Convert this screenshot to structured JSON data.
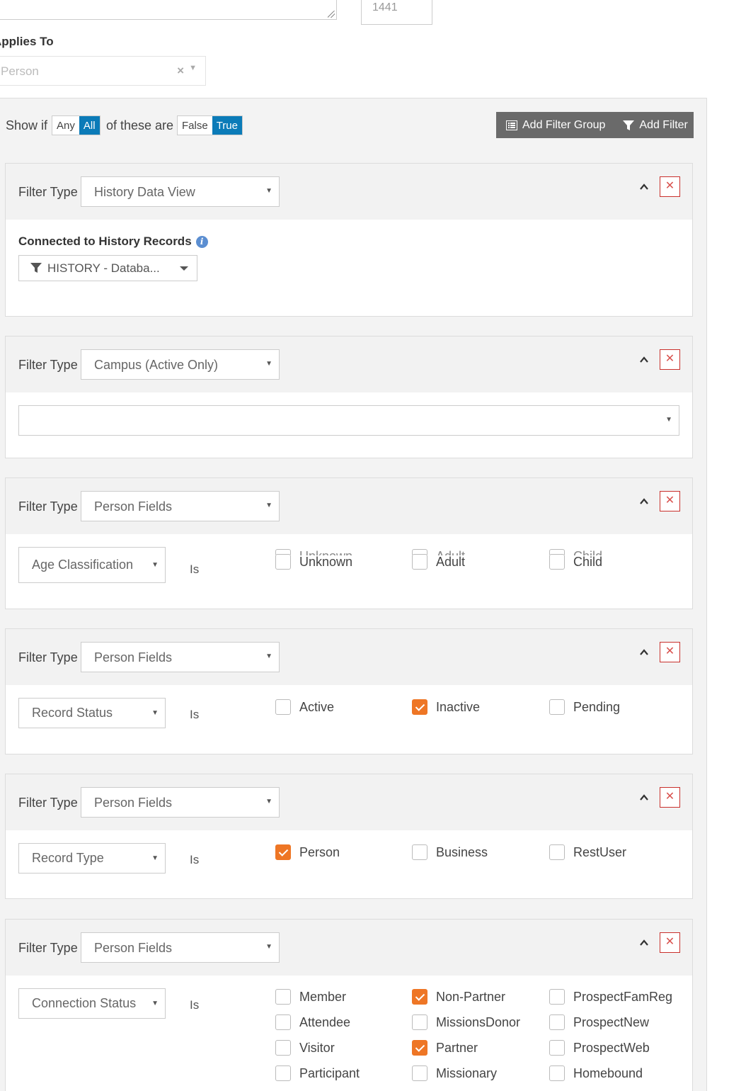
{
  "top": {
    "id_value": "1441",
    "applies_to_label": "Applies To",
    "applies_to_value": "Person"
  },
  "group": {
    "show_if_label": "Show if",
    "any_label": "Any",
    "all_label": "All",
    "of_these_label": "of these are",
    "false_label": "False",
    "true_label": "True",
    "selected_match": "All",
    "selected_truth": "True",
    "add_filter_group_label": "Add Filter Group",
    "add_filter_label": "Add Filter"
  },
  "filter_type_label": "Filter Type",
  "is_label": "Is",
  "filters": [
    {
      "type": "History Data View",
      "connected_label": "Connected to History Records",
      "dataview_value": "HISTORY - Databa..."
    },
    {
      "type": "Campus (Active Only)",
      "campus_value": ""
    },
    {
      "type": "Person Fields",
      "field": "Age Classification",
      "options": [
        {
          "label": "Unknown",
          "checked": false
        },
        {
          "label": "Adult",
          "checked": false
        },
        {
          "label": "Child",
          "checked": false
        }
      ]
    },
    {
      "type": "Person Fields",
      "field": "Record Status",
      "options": [
        {
          "label": "Active",
          "checked": false
        },
        {
          "label": "Inactive",
          "checked": true
        },
        {
          "label": "Pending",
          "checked": false
        }
      ]
    },
    {
      "type": "Person Fields",
      "field": "Record Type",
      "options": [
        {
          "label": "Person",
          "checked": true
        },
        {
          "label": "Business",
          "checked": false
        },
        {
          "label": "RestUser",
          "checked": false
        }
      ]
    },
    {
      "type": "Person Fields",
      "field": "Connection Status",
      "options": [
        {
          "label": "Member",
          "checked": false
        },
        {
          "label": "Non-Partner",
          "checked": true
        },
        {
          "label": "ProspectFamReg",
          "checked": false
        },
        {
          "label": "Attendee",
          "checked": false
        },
        {
          "label": "MissionsDonor",
          "checked": false
        },
        {
          "label": "ProspectNew",
          "checked": false
        },
        {
          "label": "Visitor",
          "checked": false
        },
        {
          "label": "Partner",
          "checked": true
        },
        {
          "label": "ProspectWeb",
          "checked": false
        },
        {
          "label": "Participant",
          "checked": false
        },
        {
          "label": "Missionary",
          "checked": false
        },
        {
          "label": "Homebound",
          "checked": false
        }
      ]
    }
  ],
  "colors": {
    "accent_blue": "#0b7bb8",
    "checkbox_orange": "#ee7625",
    "delete_red": "#d9534f",
    "header_gray": "#f2f2f2",
    "button_gray": "#6a6a6a"
  }
}
